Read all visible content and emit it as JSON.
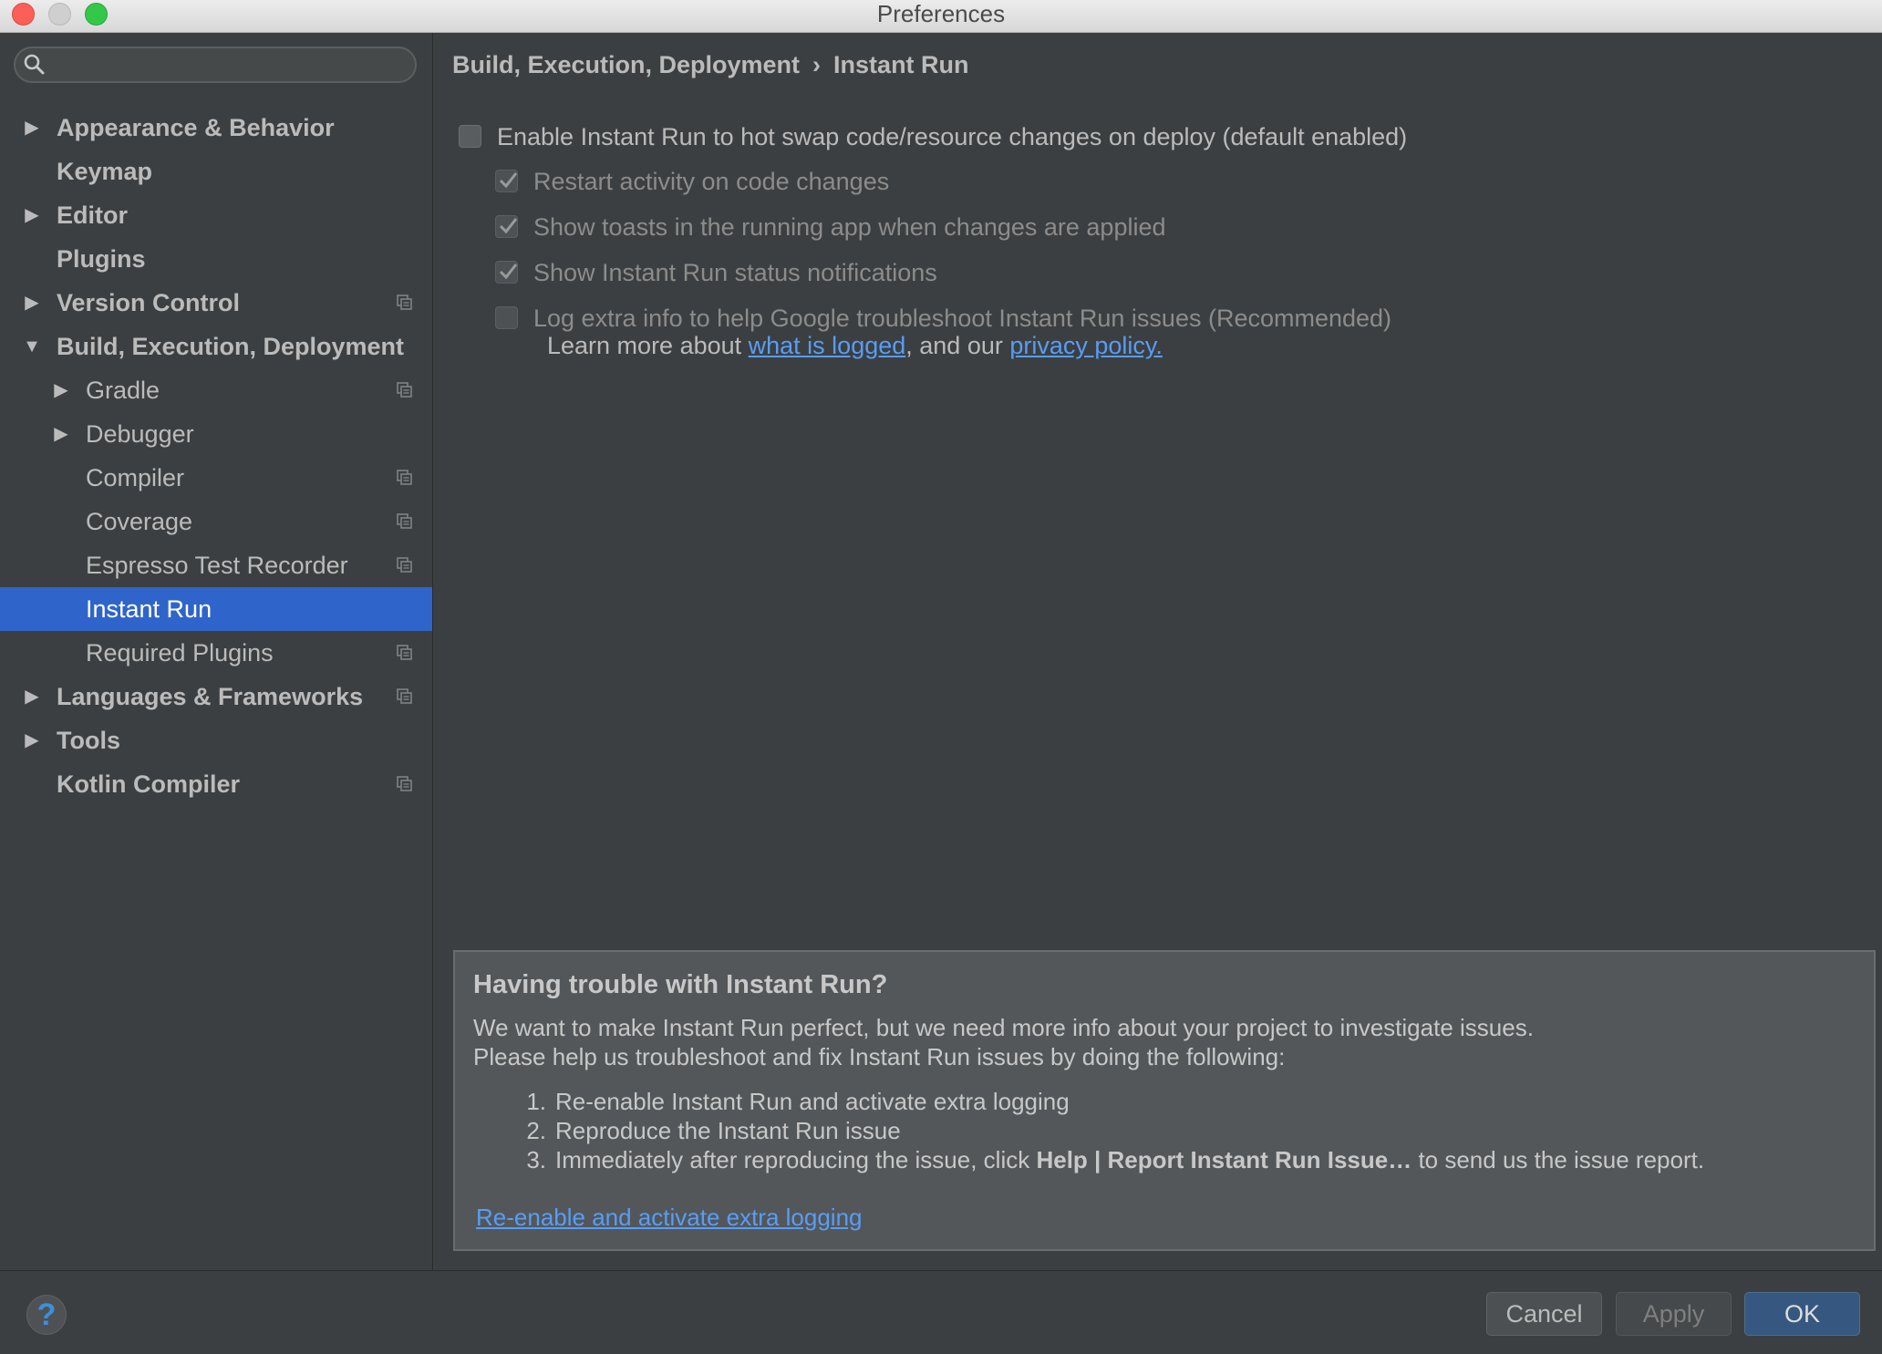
{
  "window": {
    "title": "Preferences"
  },
  "search": {
    "placeholder": "",
    "value": ""
  },
  "sidebar": {
    "items": [
      {
        "label": "Appearance & Behavior",
        "level": 0,
        "arrow": "right",
        "bold": true,
        "project_icon": false,
        "selected": false
      },
      {
        "label": "Keymap",
        "level": 0,
        "arrow": "",
        "bold": true,
        "project_icon": false,
        "selected": false
      },
      {
        "label": "Editor",
        "level": 0,
        "arrow": "right",
        "bold": true,
        "project_icon": false,
        "selected": false
      },
      {
        "label": "Plugins",
        "level": 0,
        "arrow": "",
        "bold": true,
        "project_icon": false,
        "selected": false
      },
      {
        "label": "Version Control",
        "level": 0,
        "arrow": "right",
        "bold": true,
        "project_icon": true,
        "selected": false
      },
      {
        "label": "Build, Execution, Deployment",
        "level": 0,
        "arrow": "down",
        "bold": true,
        "project_icon": false,
        "selected": false
      },
      {
        "label": "Gradle",
        "level": 1,
        "arrow": "right",
        "bold": false,
        "project_icon": true,
        "selected": false
      },
      {
        "label": "Debugger",
        "level": 1,
        "arrow": "right",
        "bold": false,
        "project_icon": false,
        "selected": false
      },
      {
        "label": "Compiler",
        "level": 1,
        "arrow": "",
        "bold": false,
        "project_icon": true,
        "selected": false
      },
      {
        "label": "Coverage",
        "level": 1,
        "arrow": "",
        "bold": false,
        "project_icon": true,
        "selected": false
      },
      {
        "label": "Espresso Test Recorder",
        "level": 1,
        "arrow": "",
        "bold": false,
        "project_icon": true,
        "selected": false
      },
      {
        "label": "Instant Run",
        "level": 1,
        "arrow": "",
        "bold": false,
        "project_icon": false,
        "selected": true
      },
      {
        "label": "Required Plugins",
        "level": 1,
        "arrow": "",
        "bold": false,
        "project_icon": true,
        "selected": false
      },
      {
        "label": "Languages & Frameworks",
        "level": 0,
        "arrow": "right",
        "bold": true,
        "project_icon": true,
        "selected": false
      },
      {
        "label": "Tools",
        "level": 0,
        "arrow": "right",
        "bold": true,
        "project_icon": false,
        "selected": false
      },
      {
        "label": "Kotlin Compiler",
        "level": 0,
        "arrow": "",
        "bold": true,
        "project_icon": true,
        "selected": false
      }
    ]
  },
  "breadcrumb": {
    "parent": "Build, Execution, Deployment",
    "separator": "›",
    "current": "Instant Run"
  },
  "options": [
    {
      "label": "Enable Instant Run to hot swap code/resource changes on deploy (default enabled)",
      "checked": false,
      "enabled": true,
      "indent": 0
    },
    {
      "label": "Restart activity on code changes",
      "checked": true,
      "enabled": false,
      "indent": 1
    },
    {
      "label": "Show toasts in the running app when changes are applied",
      "checked": true,
      "enabled": false,
      "indent": 1
    },
    {
      "label": "Show Instant Run status notifications",
      "checked": true,
      "enabled": false,
      "indent": 1
    },
    {
      "label": "Log extra info to help Google troubleshoot Instant Run issues (Recommended)",
      "checked": false,
      "enabled": false,
      "indent": 1
    }
  ],
  "learn_more": {
    "prefix": "Learn more about ",
    "link1": "what is logged",
    "middle": ", and our ",
    "link2": "privacy policy."
  },
  "help_panel": {
    "title": "Having trouble with Instant Run?",
    "line1": "We want to make Instant Run perfect, but we need more info about your project to investigate issues.",
    "line2": "Please help us troubleshoot and fix Instant Run issues by doing the following:",
    "steps": [
      {
        "num": "1.",
        "text": "Re-enable Instant Run and activate extra logging"
      },
      {
        "num": "2.",
        "text": "Reproduce the Instant Run issue"
      },
      {
        "num": "3.",
        "text_before": "Immediately after reproducing the issue, click ",
        "bold": "Help | Report Instant Run Issue…",
        "text_after": " to send us the issue report."
      }
    ],
    "link": "Re-enable and activate extra logging"
  },
  "buttons": {
    "help": "?",
    "cancel": "Cancel",
    "apply": "Apply",
    "ok": "OK"
  },
  "colors": {
    "selection": "#2f65ca",
    "link": "#589df6",
    "ok_button": "#365880",
    "background": "#3c3f41",
    "panel": "#53575a"
  }
}
